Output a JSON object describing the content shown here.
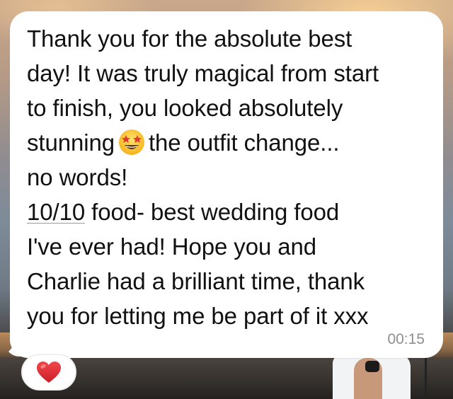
{
  "message": {
    "lines": [
      "Thank you for the absolute best",
      "day! It was truly magical from start",
      "to finish, you looked absolutely",
      "stunning",
      "the outfit change...",
      "no words!",
      "10/10",
      " food- best wedding food",
      "I've ever had! Hope you and",
      "Charlie had a brilliant time, thank",
      "you for letting me be part of it xxx"
    ],
    "emoji": "star-struck-emoji",
    "timestamp": "00:15"
  },
  "reaction": {
    "icon": "red-heart-icon",
    "color": "#e0282e"
  },
  "colors": {
    "bubble": "#ffffff",
    "text": "#111111",
    "timestamp": "#8e8e93"
  }
}
